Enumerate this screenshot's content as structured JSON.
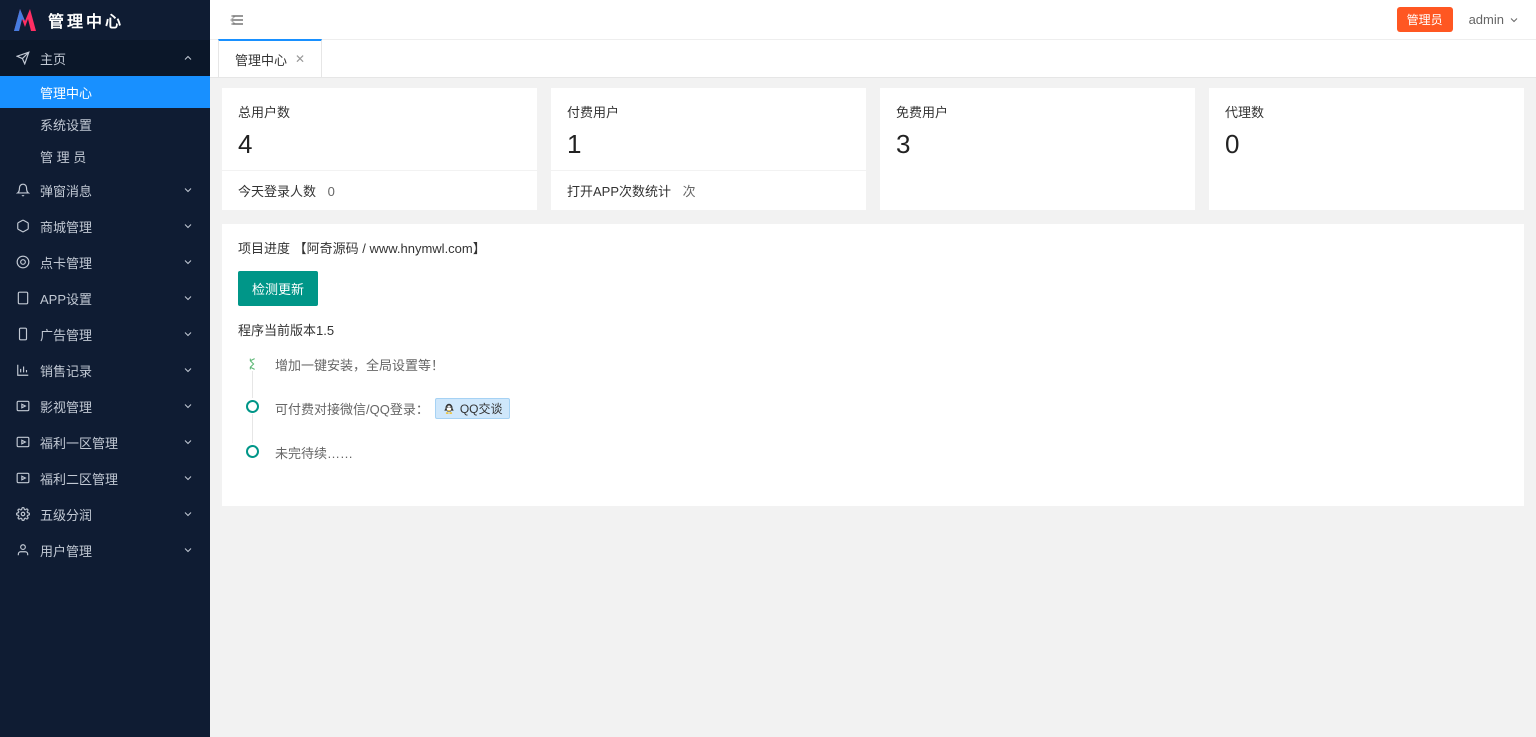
{
  "app_title": "管理中心",
  "topbar": {
    "role_badge": "管理员",
    "user": "admin"
  },
  "tabs": [
    {
      "label": "管理中心",
      "active": true,
      "closable": true
    }
  ],
  "sidebar": {
    "home": {
      "label": "主页",
      "expanded": true
    },
    "home_children": [
      {
        "label": "管理中心",
        "active": true
      },
      {
        "label": "系统设置",
        "active": false
      },
      {
        "label": "管 理 员",
        "active": false
      }
    ],
    "groups": [
      {
        "label": "弹窗消息",
        "icon": "bell"
      },
      {
        "label": "商城管理",
        "icon": "cube"
      },
      {
        "label": "点卡管理",
        "icon": "target"
      },
      {
        "label": "APP设置",
        "icon": "tablet"
      },
      {
        "label": "广告管理",
        "icon": "mobile"
      },
      {
        "label": "销售记录",
        "icon": "chart"
      },
      {
        "label": "影视管理",
        "icon": "play"
      },
      {
        "label": "福利一区管理",
        "icon": "play"
      },
      {
        "label": "福利二区管理",
        "icon": "play"
      },
      {
        "label": "五级分润",
        "icon": "gear"
      },
      {
        "label": "用户管理",
        "icon": "user"
      }
    ]
  },
  "stats": [
    {
      "title": "总用户数",
      "value": "4",
      "footer_label": "今天登录人数",
      "footer_value": "0"
    },
    {
      "title": "付费用户",
      "value": "1",
      "footer_label": "打开APP次数统计",
      "footer_value": "次"
    },
    {
      "title": "免费用户",
      "value": "3",
      "footer_label": "",
      "footer_value": ""
    },
    {
      "title": "代理数",
      "value": "0",
      "footer_label": "",
      "footer_value": ""
    }
  ],
  "project": {
    "title": "项目进度 【阿奇源码 / www.hnymwl.com】",
    "check_update_btn": "检测更新",
    "version_prefix": "程序当前版本",
    "version": "1.5",
    "timeline": [
      {
        "text": "增加一键安装，全局设置等！",
        "pointer": true
      },
      {
        "text": "可付费对接微信/QQ登录：",
        "qq_badge": "QQ交谈"
      },
      {
        "text": "未完待续……"
      }
    ]
  }
}
